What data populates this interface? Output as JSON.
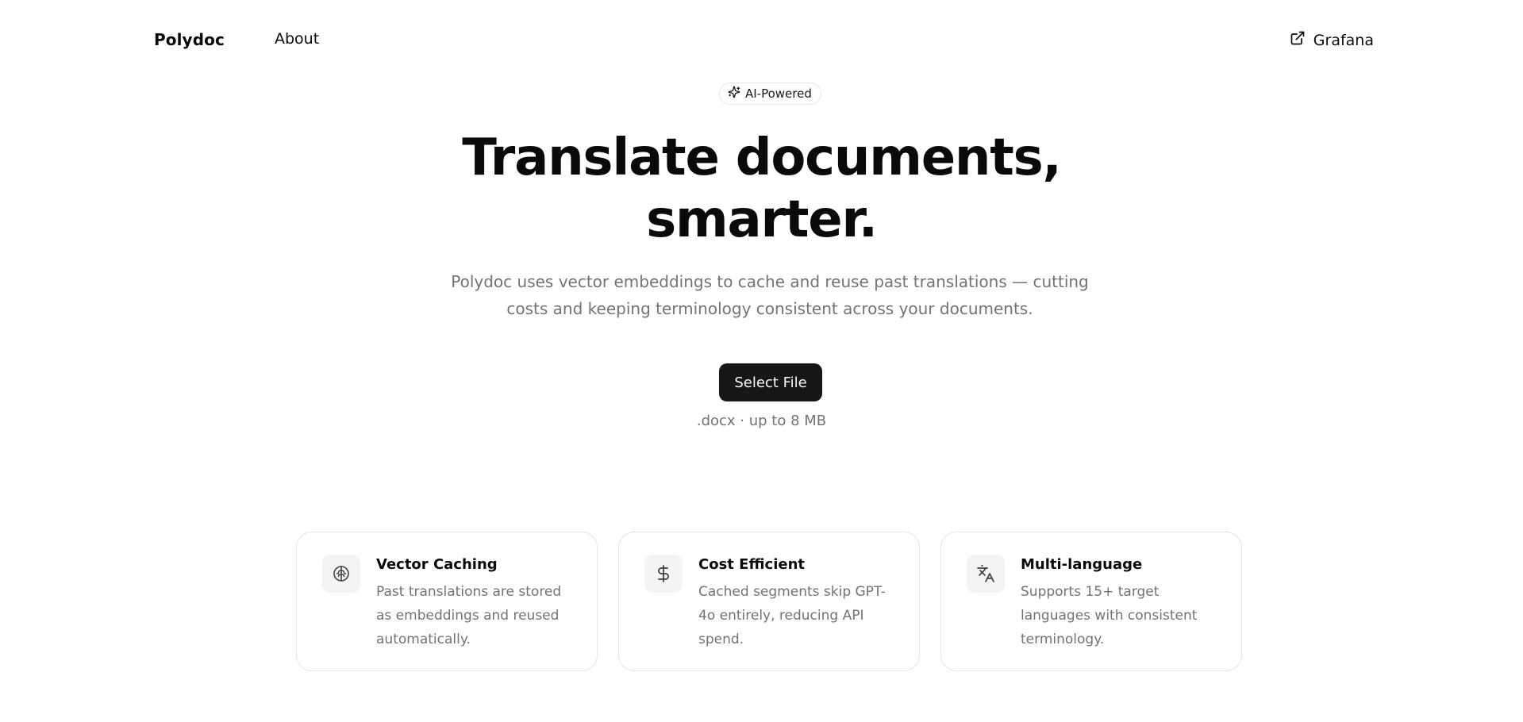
{
  "nav": {
    "brand": "Polydoc",
    "about_label": "About",
    "grafana_label": "Grafana"
  },
  "hero": {
    "badge": "AI-Powered",
    "headline_line1": "Translate documents,",
    "headline_line2": "smarter.",
    "subtitle": "Polydoc uses vector embeddings to cache and reuse past translations — cutting costs and keeping terminology consistent across your documents.",
    "select_button": "Select File",
    "file_hint": ".docx · up to 8 MB"
  },
  "features": [
    {
      "icon": "brain-icon",
      "title": "Vector Caching",
      "description": "Past translations are stored as embeddings and reused automatically."
    },
    {
      "icon": "dollar-icon",
      "title": "Cost Efficient",
      "description": "Cached segments skip GPT-4o entirely, reducing API spend."
    },
    {
      "icon": "languages-icon",
      "title": "Multi-language",
      "description": "Supports 15+ target languages with consistent terminology."
    }
  ],
  "colors": {
    "primary": "#171717",
    "muted_text": "#737373",
    "border": "#e5e5e5",
    "icon_bg": "#f4f4f5"
  }
}
